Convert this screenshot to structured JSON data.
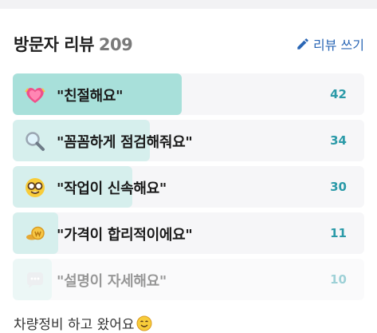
{
  "header": {
    "title": "방문자 리뷰",
    "count": "209",
    "write_label": "리뷰 쓰기"
  },
  "colors": {
    "accent": "#2b9aa8",
    "bar_top": "#a8e0da",
    "bar_rest": "#d6efed",
    "row_bg": "#f6f6f8",
    "link": "#2a66b5"
  },
  "reviews": [
    {
      "icon": "heart-icon",
      "label": "\"친절해요\"",
      "count": "42",
      "fraction": 0.48
    },
    {
      "icon": "magnifier-icon",
      "label": "\"꼼꼼하게 점검해줘요\"",
      "count": "34",
      "fraction": 0.39
    },
    {
      "icon": "nerd-face-icon",
      "label": "\"작업이 신속해요\"",
      "count": "30",
      "fraction": 0.34
    },
    {
      "icon": "money-icon",
      "label": "\"가격이 합리적이에요\"",
      "count": "11",
      "fraction": 0.13
    },
    {
      "icon": "speech-bubble-icon",
      "label": "\"설명이 자세해요\"",
      "count": "10",
      "fraction": 0.11
    }
  ],
  "snippet": {
    "text": "차량정비 하고 왔어요"
  }
}
